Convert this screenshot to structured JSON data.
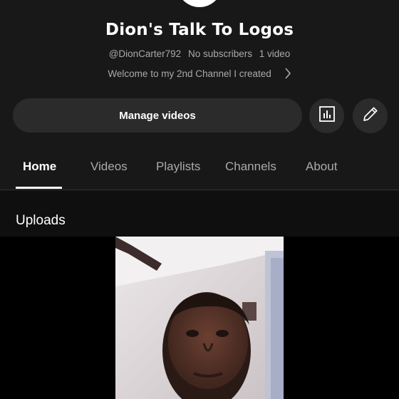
{
  "channel": {
    "name": "Dion's Talk To Logos",
    "handle": "@DionCarter792",
    "subscribers": "No subscribers",
    "video_count": "1 video",
    "description": "Welcome to my 2nd Channel I created"
  },
  "actions": {
    "manage_label": "Manage videos",
    "analytics_icon": "bar-chart-icon",
    "edit_icon": "pencil-icon"
  },
  "tabs": [
    {
      "label": "Home",
      "active": true
    },
    {
      "label": "Videos",
      "active": false
    },
    {
      "label": "Playlists",
      "active": false
    },
    {
      "label": "Channels",
      "active": false
    },
    {
      "label": "About",
      "active": false
    }
  ],
  "uploads": {
    "title": "Uploads"
  },
  "colors": {
    "background": "#0f0f0f",
    "header": "#181818",
    "button": "#2b2b2b",
    "text_primary": "#ffffff",
    "text_secondary": "#aaaaaa"
  }
}
